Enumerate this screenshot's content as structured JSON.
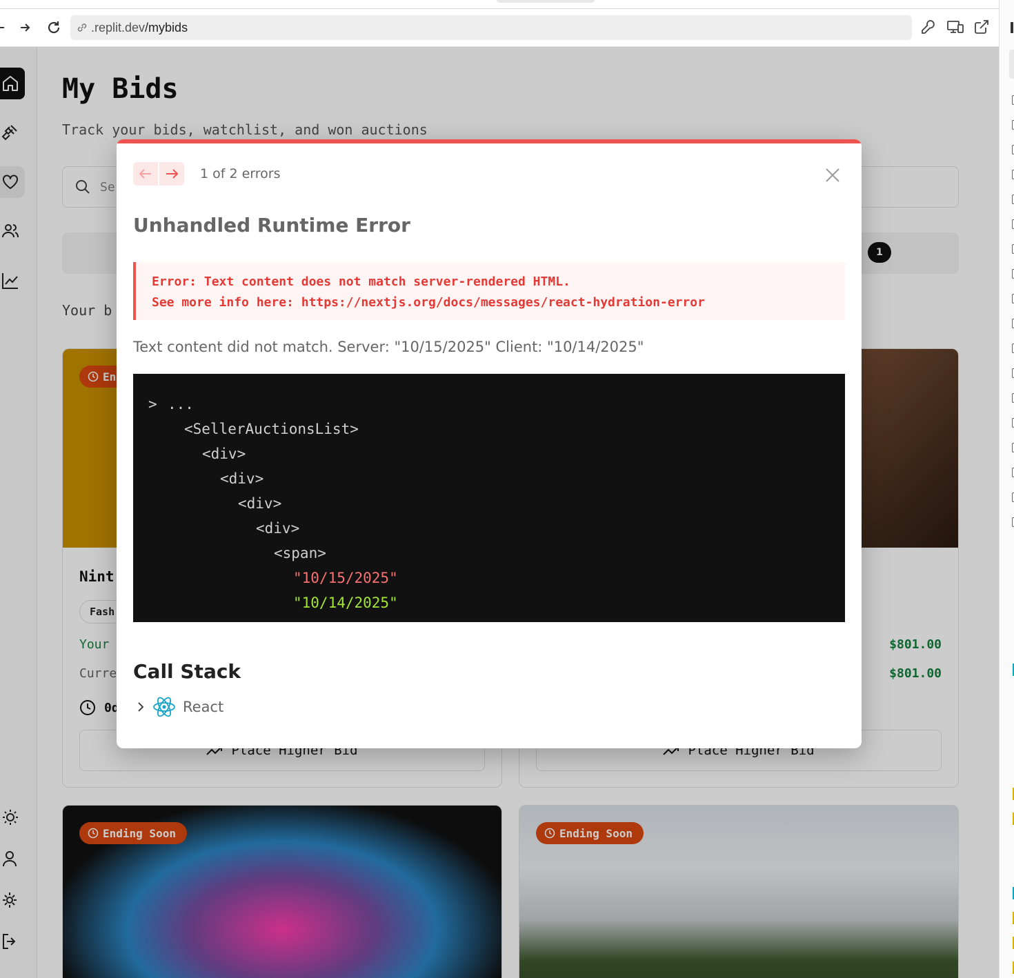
{
  "browser": {
    "url_host": ".replit.dev",
    "url_path": "/mybids"
  },
  "page": {
    "title": "My Bids",
    "subtitle": "Track your bids, watchlist, and won auctions",
    "search_placeholder": "Se",
    "tab_badge_count": "1",
    "section_label": "Your b"
  },
  "cards": [
    {
      "badge": "En",
      "title": "Nint",
      "chip": "Fash",
      "your_bid_label": "Your",
      "current_label": "Curre",
      "time_left": "0d",
      "button": "Place Higher Bid",
      "image_color": "#c98f00"
    },
    {
      "your_bid_value": "$801.00",
      "current_value": "$801.00",
      "button": "Place Higher Bid",
      "image_color": "#7a4a30"
    },
    {
      "badge": "Ending Soon"
    },
    {
      "badge": "Ending Soon"
    }
  ],
  "error_overlay": {
    "count_text": "1 of 2 errors",
    "title": "Unhandled Runtime Error",
    "message_line1": "Error: Text content does not match server-rendered HTML.",
    "message_line2": "See more info here: https://nextjs.org/docs/messages/react-hydration-error",
    "description": "Text content did not match. Server: \"10/15/2025\" Client: \"10/14/2025\"",
    "code": {
      "ellipsis": "...",
      "line1": "<SellerAuctionsList>",
      "line2": "<div>",
      "line3": "<div>",
      "line4": "<div>",
      "line5": "<div>",
      "line6": "<span>",
      "server_value": "\"10/15/2025\"",
      "client_value": "\"10/14/2025\""
    },
    "call_stack_title": "Call Stack",
    "call_stack_item": "React"
  },
  "colors": {
    "accent_error": "#ef5350",
    "badge_orange": "#d9480f",
    "price_green": "#15803d"
  }
}
